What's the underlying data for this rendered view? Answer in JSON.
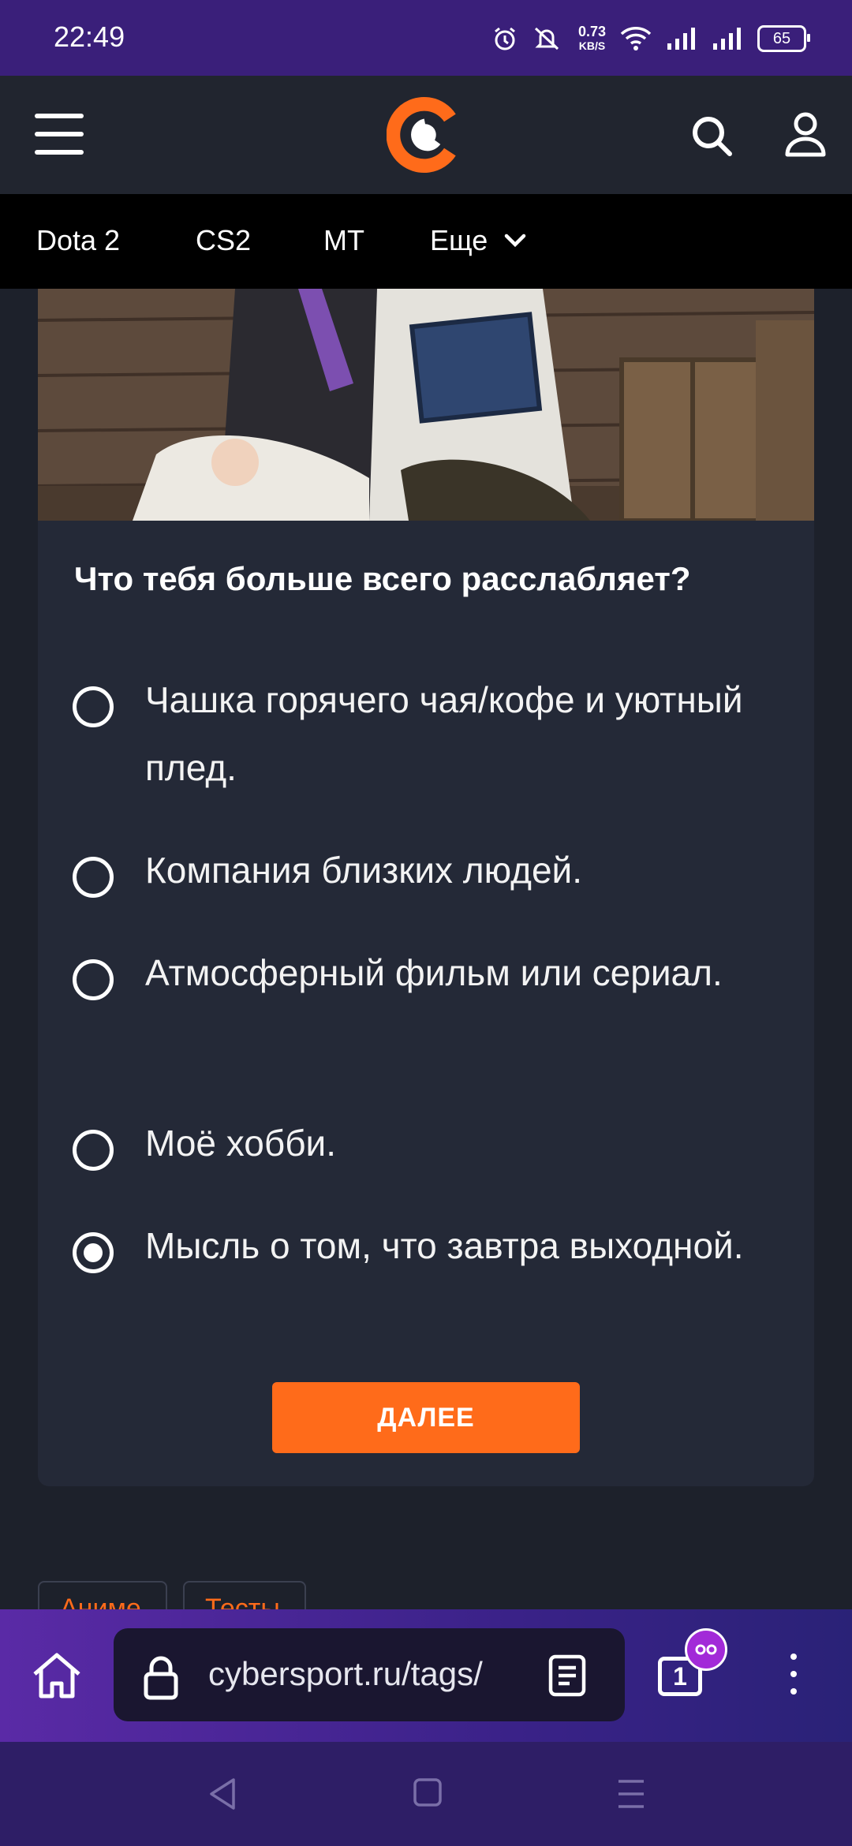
{
  "status_bar": {
    "time": "22:49",
    "net_speed_value": "0.73",
    "net_speed_unit": "KB/S",
    "battery": "65"
  },
  "header": {
    "logo_icon": "cybersport-logo",
    "menu_icon": "hamburger-icon",
    "search_icon": "search-icon",
    "user_icon": "user-icon"
  },
  "nav": {
    "items": [
      "Dota 2",
      "CS2",
      "MT"
    ],
    "more_label": "Еще"
  },
  "quiz": {
    "question": "Что тебя больше всего расслабляет?",
    "options": [
      {
        "label": "Чашка горячего чая/кофе и уютный плед.",
        "selected": false
      },
      {
        "label": "Компания близких людей.",
        "selected": false
      },
      {
        "label": "Атмосферный фильм или сериал.",
        "selected": false
      },
      {
        "label": "Моё хобби.",
        "selected": false
      },
      {
        "label": "Мысль о том, что завтра выходной.",
        "selected": true
      }
    ],
    "next_label": "ДАЛЕЕ"
  },
  "tags": [
    "Аниме",
    "Тесты"
  ],
  "browser": {
    "url": "cybersport.ru/tags/",
    "tab_count": "1"
  },
  "colors": {
    "accent": "#ff6b1a",
    "card_bg": "#242937",
    "page_bg": "#1d212b",
    "status_bar": "#3a1f7a"
  }
}
